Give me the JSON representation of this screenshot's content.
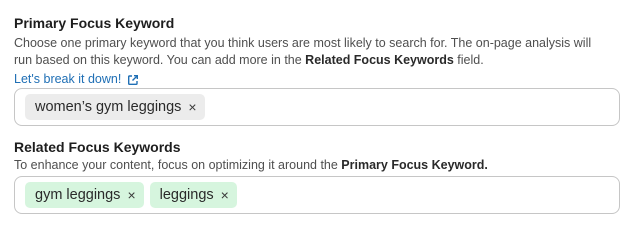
{
  "primary": {
    "label": "Primary Focus Keyword",
    "help_line1": "Choose one primary keyword that you think users are most likely to search for. The on-page analysis will",
    "help_line2_prefix": "run based on this keyword. You can add more in the ",
    "help_line2_bold": "Related Focus Keywords",
    "help_line2_suffix": " field.",
    "link_text": "Let's break it down!",
    "link_icon": "external-link-icon",
    "chips": [
      {
        "text": "women’s gym leggings",
        "remove": "×"
      }
    ]
  },
  "related": {
    "label": "Related Focus Keywords",
    "help_prefix": "To enhance your content, focus on optimizing it around the ",
    "help_bold": "Primary Focus Keyword.",
    "chips": [
      {
        "text": "gym leggings",
        "remove": "×"
      },
      {
        "text": "leggings",
        "remove": "×"
      }
    ]
  },
  "colors": {
    "link": "#1f6fb5",
    "chip_primary_bg": "#ececec",
    "chip_related_bg": "#d6f5de",
    "field_border": "#c6c6c6"
  }
}
